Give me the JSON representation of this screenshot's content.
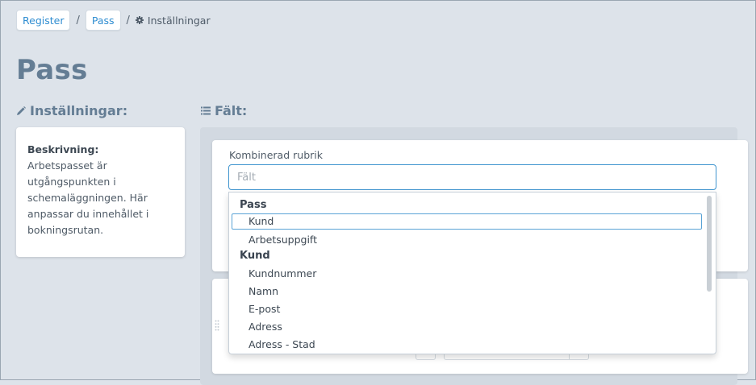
{
  "breadcrumb": {
    "items": [
      {
        "label": "Register"
      },
      {
        "label": "Pass"
      }
    ],
    "separator": "/",
    "current": "Inställningar"
  },
  "page": {
    "title": "Pass"
  },
  "settings": {
    "heading": "Inställningar:",
    "description_label": "Beskrivning:",
    "description_lines": [
      "Arbetspasset är",
      "utgångspunkten i",
      "schemaläggningen. Här",
      "anpassar du innehållet i",
      "bokningsrutan."
    ]
  },
  "fields": {
    "heading": "Fält:",
    "combined_label": "Kombinerad rubrik",
    "input_placeholder": "Fält",
    "input_value": "",
    "dropdown": {
      "groups": [
        {
          "label": "Pass",
          "options": [
            "Kund",
            "Arbetsuppgift"
          ]
        },
        {
          "label": "Kund",
          "options": [
            "Kundnummer",
            "Namn",
            "E-post",
            "Adress",
            "Adress - Stad"
          ]
        }
      ],
      "highlighted": "Kund"
    }
  },
  "colors": {
    "accent": "#2f8dd1",
    "title": "#647d94",
    "background": "#dde3ea"
  },
  "icons": {
    "current_crumb": "gear-icon",
    "settings_heading": "pencil-icon",
    "fields_heading": "list-icon"
  }
}
